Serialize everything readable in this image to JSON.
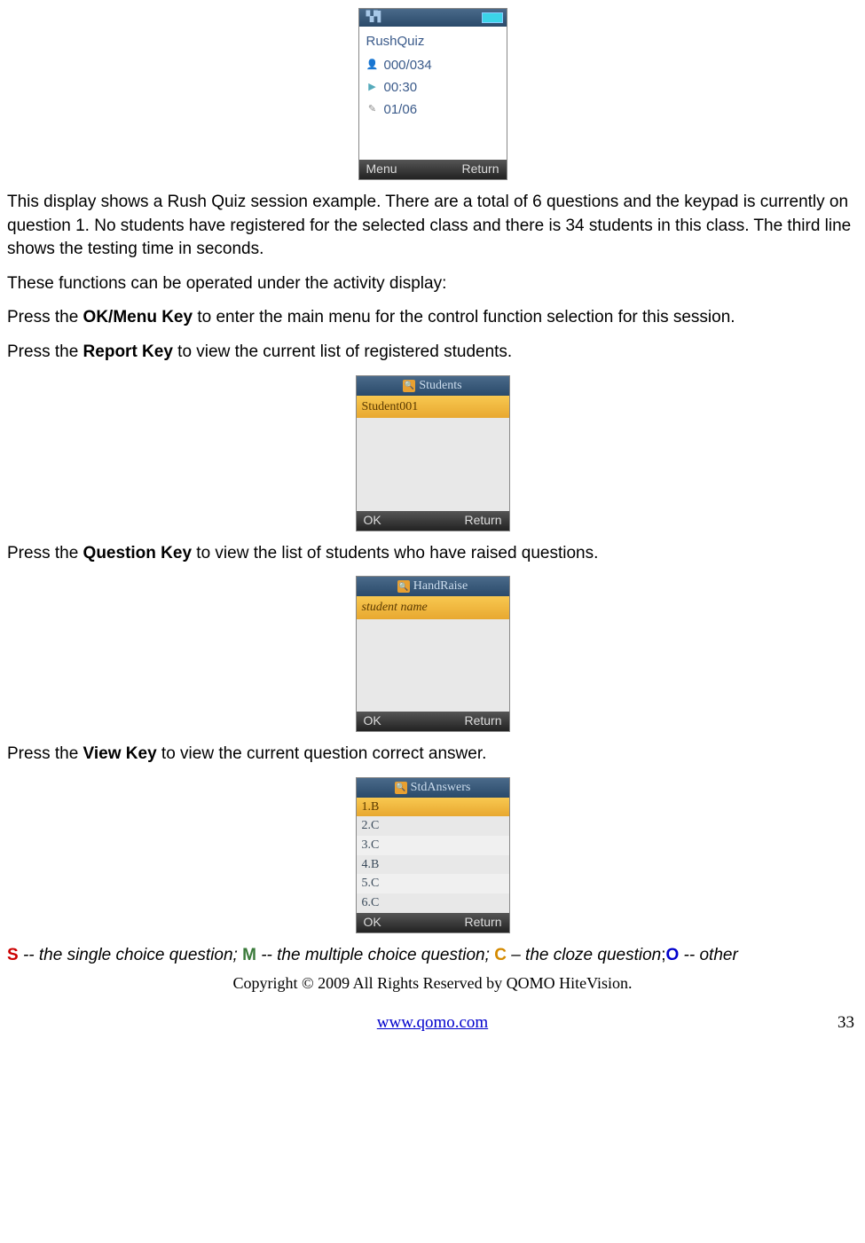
{
  "rushquiz_screen": {
    "title": "RushQuiz",
    "students_count": "000/034",
    "timer": "00:30",
    "question_progress": "01/06",
    "menu_label": "Menu",
    "return_label": "Return"
  },
  "para1": "This display shows a Rush Quiz session example. There are a total of 6 questions and the keypad is currently on question 1. No students have registered for the selected class and there is  34 students in this class. The third line shows the testing time in seconds.",
  "para2": "These functions can be operated under the activity display:",
  "para3_prefix": "Press the ",
  "para3_key": "OK/Menu Key",
  "para3_suffix": " to enter the main menu for the control function selection for this session.",
  "para4_prefix": "Press the ",
  "para4_key": "Report Key",
  "para4_suffix": " to view the current list of registered students.",
  "students_screen": {
    "header": "Students",
    "highlight": "Student001",
    "ok_label": "OK",
    "return_label": "Return"
  },
  "para5_prefix": "Press the ",
  "para5_key": "Question Key",
  "para5_suffix": " to view the list of students who have raised questions.",
  "handraise_screen": {
    "header": "HandRaise",
    "highlight": "student name",
    "ok_label": "OK",
    "return_label": "Return"
  },
  "para6_prefix": "Press the ",
  "para6_key": "View Key",
  "para6_suffix": " to view the current question correct answer.",
  "answers_screen": {
    "header": "StdAnswers",
    "answers": [
      "1.B",
      "2.C",
      "3.C",
      "4.B",
      "5.C",
      "6.C"
    ],
    "ok_label": "OK",
    "return_label": "Return"
  },
  "legend": {
    "S": "S",
    "s_text": " -- the single choice question; ",
    "M": "M",
    "m_text": " -- the multiple choice question; ",
    "C": "C",
    "c_text": " – the cloze question",
    "semicolon": ";",
    "O": "O",
    "o_text": " -- other"
  },
  "copyright": "Copyright © 2009 All Rights Reserved by QOMO HiteVision.",
  "footer_link": "www.qomo.com",
  "page_number": "33"
}
